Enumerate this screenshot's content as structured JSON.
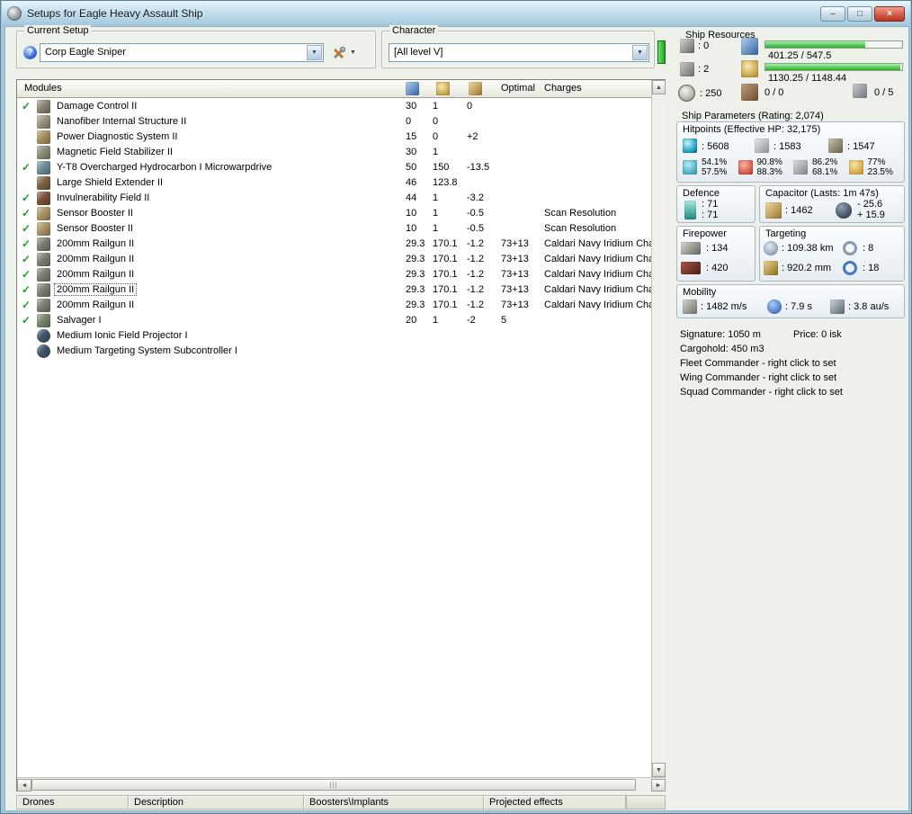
{
  "window": {
    "title": "Setups for Eagle Heavy Assault Ship",
    "buttons": {
      "minimize": "–",
      "maximize": "□",
      "close": "×"
    }
  },
  "setup": {
    "label": "Current Setup",
    "value": "Corp Eagle Sniper"
  },
  "character": {
    "label": "Character",
    "value": "[All level V]"
  },
  "resources": {
    "label": "Ship Resources",
    "turrets": ": 0",
    "launchers": ": 2",
    "calibration": ": 250",
    "cpu": "401.25 / 547.5",
    "powergrid": "1130.25 / 1148.44",
    "drones": "0 / 0",
    "upgrades": "0 / 5"
  },
  "table": {
    "modules_header": "Modules",
    "optimal_header": "Optimal",
    "charges_header": "Charges",
    "rows": [
      {
        "active": true,
        "name": "Damage Control II",
        "cpu": "30",
        "pg": "1",
        "cap": "0",
        "optimal": "",
        "charges": "",
        "color": "#8c8374",
        "round": false,
        "selected": false
      },
      {
        "active": false,
        "name": "Nanofiber Internal Structure II",
        "cpu": "0",
        "pg": "0",
        "cap": "",
        "optimal": "",
        "charges": "",
        "color": "#98937f",
        "round": false,
        "selected": false
      },
      {
        "active": false,
        "name": "Power Diagnostic System II",
        "cpu": "15",
        "pg": "0",
        "cap": "+2",
        "optimal": "",
        "charges": "",
        "color": "#a5905f",
        "round": false,
        "selected": false
      },
      {
        "active": false,
        "name": "Magnetic Field Stabilizer II",
        "cpu": "30",
        "pg": "1",
        "cap": "",
        "optimal": "",
        "charges": "",
        "color": "#8e8b7a",
        "round": false,
        "selected": false
      },
      {
        "active": true,
        "name": "Y-T8 Overcharged Hydrocarbon I Microwarpdrive",
        "cpu": "50",
        "pg": "150",
        "cap": "-13.5",
        "optimal": "",
        "charges": "",
        "color": "#6d8d98",
        "round": false,
        "selected": false
      },
      {
        "active": false,
        "name": "Large Shield Extender II",
        "cpu": "46",
        "pg": "123.8",
        "cap": "",
        "optimal": "",
        "charges": "",
        "color": "#7d6343",
        "round": false,
        "selected": false
      },
      {
        "active": true,
        "name": "Invulnerability Field II",
        "cpu": "44",
        "pg": "1",
        "cap": "-3.2",
        "optimal": "",
        "charges": "",
        "color": "#7e503c",
        "round": false,
        "selected": false
      },
      {
        "active": true,
        "name": "Sensor Booster II",
        "cpu": "10",
        "pg": "1",
        "cap": "-0.5",
        "optimal": "",
        "charges": "Scan Resolution",
        "color": "#ab9566",
        "round": false,
        "selected": false
      },
      {
        "active": true,
        "name": "Sensor Booster II",
        "cpu": "10",
        "pg": "1",
        "cap": "-0.5",
        "optimal": "",
        "charges": "Scan Resolution",
        "color": "#ab9566",
        "round": false,
        "selected": false
      },
      {
        "active": true,
        "name": "200mm Railgun II",
        "cpu": "29.3",
        "pg": "170.1",
        "cap": "-1.2",
        "optimal": "73+13",
        "charges": "Caldari Navy Iridium Char...",
        "color": "#7e7e75",
        "round": false,
        "selected": false
      },
      {
        "active": true,
        "name": "200mm Railgun II",
        "cpu": "29.3",
        "pg": "170.1",
        "cap": "-1.2",
        "optimal": "73+13",
        "charges": "Caldari Navy Iridium Char...",
        "color": "#7e7e75",
        "round": false,
        "selected": false
      },
      {
        "active": true,
        "name": "200mm Railgun II",
        "cpu": "29.3",
        "pg": "170.1",
        "cap": "-1.2",
        "optimal": "73+13",
        "charges": "Caldari Navy Iridium Char...",
        "color": "#7e7e75",
        "round": false,
        "selected": false
      },
      {
        "active": true,
        "name": "200mm Railgun II",
        "cpu": "29.3",
        "pg": "170.1",
        "cap": "-1.2",
        "optimal": "73+13",
        "charges": "Caldari Navy Iridium Char...",
        "color": "#7e7e75",
        "round": false,
        "selected": true
      },
      {
        "active": true,
        "name": "200mm Railgun II",
        "cpu": "29.3",
        "pg": "170.1",
        "cap": "-1.2",
        "optimal": "73+13",
        "charges": "Caldari Navy Iridium Char...",
        "color": "#7e7e75",
        "round": false,
        "selected": false
      },
      {
        "active": true,
        "name": "Salvager I",
        "cpu": "20",
        "pg": "1",
        "cap": "-2",
        "optimal": "5",
        "charges": "",
        "color": "#76866b",
        "round": false,
        "selected": false
      },
      {
        "active": false,
        "name": "Medium Ionic Field Projector I",
        "cpu": "",
        "pg": "",
        "cap": "",
        "optimal": "",
        "charges": "",
        "color": "#41546a",
        "round": true,
        "selected": false
      },
      {
        "active": false,
        "name": "Medium Targeting System Subcontroller I",
        "cpu": "",
        "pg": "",
        "cap": "",
        "optimal": "",
        "charges": "",
        "color": "#41546a",
        "round": true,
        "selected": false
      }
    ]
  },
  "params": {
    "title": "Ship Parameters (Rating: 2,074)",
    "hitpoints": {
      "label": "Hitpoints (Effective HP: 32,175)",
      "shield": ": 5608",
      "armor": ": 1583",
      "hull": ": 1547",
      "resists": [
        {
          "shield": "54.1%",
          "armor": "57.5%"
        },
        {
          "shield": "90.8%",
          "armor": "88.3%"
        },
        {
          "shield": "86.2%",
          "armor": "68.1%"
        },
        {
          "shield": "77%",
          "armor": "23.5%"
        }
      ]
    },
    "defence": {
      "label": "Defence",
      "value1": ": 71",
      "value2": ": 71"
    },
    "capacitor": {
      "label": "Capacitor (Lasts: 1m 47s)",
      "amount": ": 1462",
      "drain": "- 25.6",
      "recharge": "+ 15.9"
    },
    "firepower": {
      "label": "Firepower",
      "volley": ": 134",
      "dps": ": 420"
    },
    "targeting": {
      "label": "Targeting",
      "range": ": 109.38 km",
      "max_targets": ": 8",
      "scan_resolution": ": 920.2 mm",
      "sensor_strength": ": 18"
    },
    "mobility": {
      "label": "Mobility",
      "speed": ": 1482 m/s",
      "align_time": ": 7.9 s",
      "warp_speed": ": 3.8 au/s"
    },
    "signature": "Signature: 1050 m",
    "price": "Price: 0 isk",
    "cargohold": "Cargohold: 450 m3",
    "fleet": "Fleet Commander - right click to set",
    "wing": "Wing Commander - right click to set",
    "squad": "Squad Commander - right click to set"
  },
  "footer": {
    "sections": [
      "Drones",
      "Description",
      "Boosters\\Implants",
      "Projected effects"
    ],
    "button": ""
  }
}
